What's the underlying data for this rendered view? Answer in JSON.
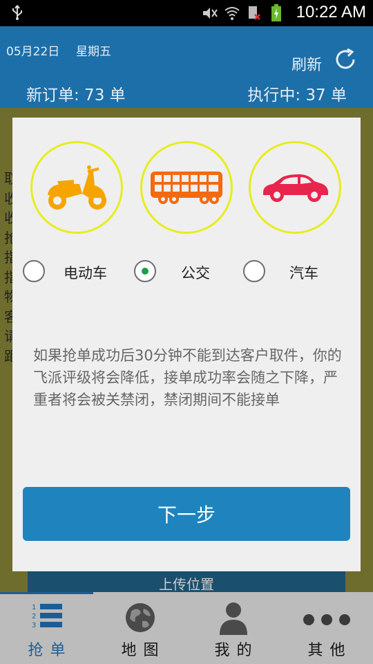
{
  "status_bar": {
    "time": "10:22 AM",
    "icons": [
      "usb-icon",
      "mute-icon",
      "wifi-icon",
      "sim-no-signal-icon",
      "battery-charging-icon"
    ]
  },
  "header": {
    "date": "05月22日",
    "weekday": "星期五",
    "refresh_label": "刷新",
    "new_orders": "新订单: 73 单",
    "in_progress": "执行中: 37 单"
  },
  "background": {
    "visible_chars": [
      "取",
      "收",
      "收",
      "抢",
      "指",
      "指",
      "物",
      "客",
      "请",
      "距"
    ],
    "upload_button": "上传位置"
  },
  "modal": {
    "vehicles": [
      {
        "name": "电动车",
        "icon": "scooter-icon",
        "color": "#f5a400",
        "checked": false
      },
      {
        "name": "公交",
        "icon": "bus-icon",
        "color": "#f36a10",
        "checked": true
      },
      {
        "name": "汽车",
        "icon": "car-icon",
        "color": "#e8254d",
        "checked": false
      }
    ],
    "notice": "如果抢单成功后30分钟不能到达客户取件，你的飞派评级将会降低，接单成功率会随之下降，严重者将会被关禁闭，禁闭期间不能接单",
    "next_button": "下一步"
  },
  "nav": {
    "items": [
      {
        "label": "抢单",
        "icon": "list-icon",
        "active": true
      },
      {
        "label": "地图",
        "icon": "globe-icon",
        "active": false
      },
      {
        "label": "我的",
        "icon": "person-icon",
        "active": false
      },
      {
        "label": "其他",
        "icon": "more-icon",
        "active": false
      }
    ]
  },
  "colors": {
    "header_bg": "#1c6fa8",
    "accent_button": "#1f84bd",
    "ring_yellow": "#e6ed1e",
    "radio_checked": "#1e9e46"
  }
}
